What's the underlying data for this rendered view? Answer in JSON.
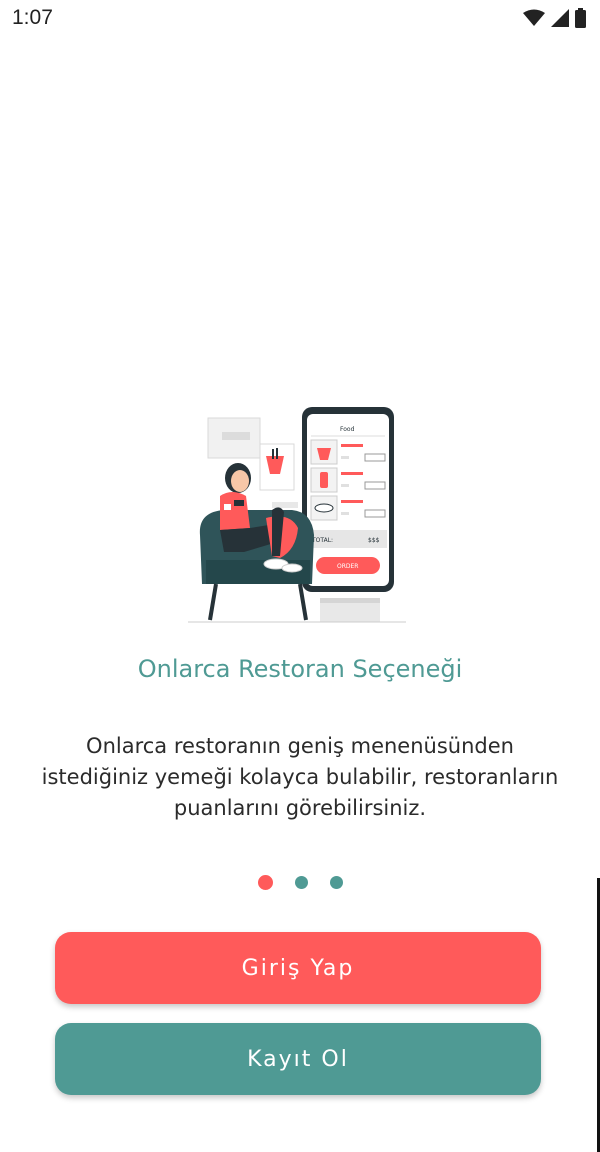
{
  "status_bar": {
    "time": "1:07"
  },
  "illustration": {
    "app_header": "Food",
    "total_label": "TOTAL:",
    "total_value": "$$$",
    "order_button": "ORDER"
  },
  "onboarding": {
    "title": "Onlarca Restoran Seçeneği",
    "description": "Onlarca restoranın geniş menenüsünden istediğiniz yemeği kolayca bulabilir, restoranların puanlarını görebilirsiniz.",
    "page_indicator": {
      "current": 1,
      "total": 3
    }
  },
  "buttons": {
    "login": "Giriş Yap",
    "register": "Kayıt Ol"
  },
  "colors": {
    "primary_red": "#ff5a5a",
    "primary_teal": "#4f9a94"
  }
}
